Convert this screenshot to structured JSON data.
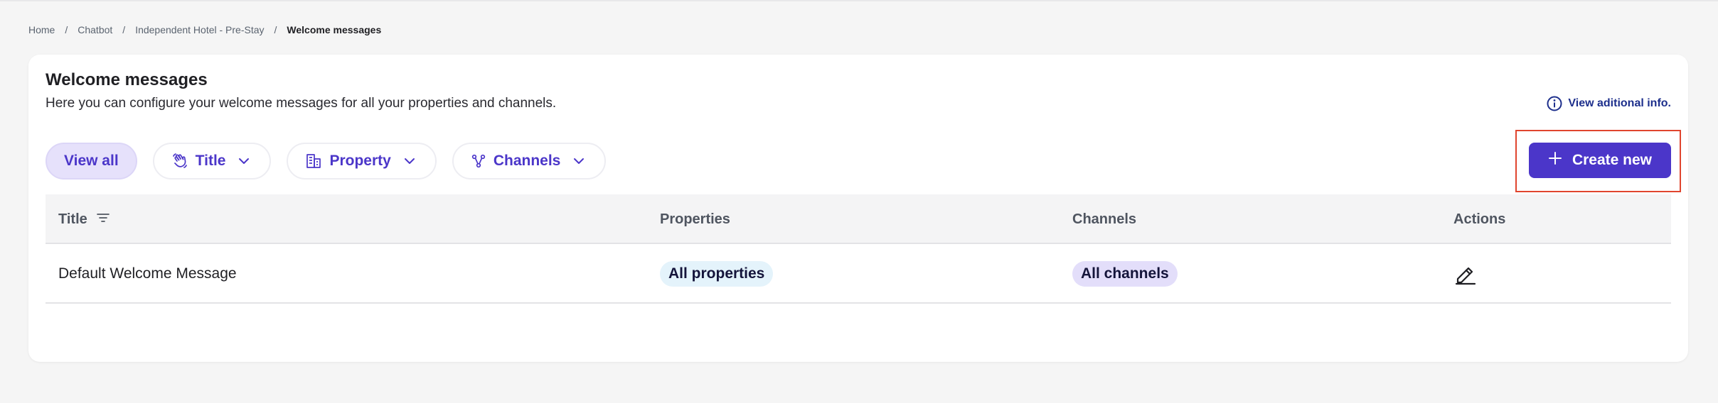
{
  "breadcrumb": {
    "items": [
      "Home",
      "Chatbot",
      "Independent Hotel - Pre-Stay"
    ],
    "current": "Welcome messages",
    "separator": "/"
  },
  "page": {
    "title": "Welcome messages",
    "subtitle": "Here you can configure your welcome messages for all your properties and channels.",
    "info_link": "View aditional info."
  },
  "filters": {
    "view_all": "View all",
    "title": "Title",
    "property": "Property",
    "channels": "Channels"
  },
  "create_button": "Create new",
  "table": {
    "headers": {
      "title": "Title",
      "properties": "Properties",
      "channels": "Channels",
      "actions": "Actions"
    },
    "rows": [
      {
        "title": "Default Welcome Message",
        "properties": "All properties",
        "channels": "All channels"
      }
    ]
  },
  "colors": {
    "accent": "#4b36c9",
    "link": "#1d2f8c",
    "highlight": "#e0452e"
  }
}
